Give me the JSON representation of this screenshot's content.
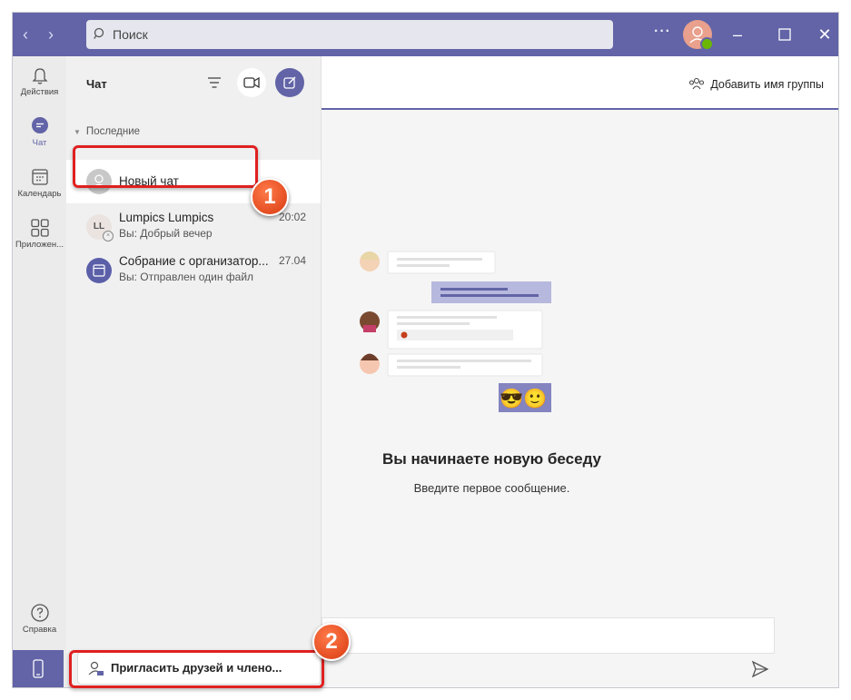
{
  "search": {
    "placeholder": "Поиск"
  },
  "titlebar": {
    "more_label": "···"
  },
  "rail": {
    "items": [
      {
        "label": "Действия",
        "icon": "bell-icon"
      },
      {
        "label": "Чат",
        "icon": "chat-icon"
      },
      {
        "label": "Календарь",
        "icon": "calendar-icon"
      },
      {
        "label": "Приложен...",
        "icon": "apps-icon"
      }
    ],
    "help_label": "Справка"
  },
  "chatlist": {
    "title": "Чат",
    "section": "Последние",
    "items": [
      {
        "name": "Новый чат",
        "preview": "",
        "time": ""
      },
      {
        "name": "Lumpics Lumpics",
        "initials": "LL",
        "preview": "Вы: Добрый вечер",
        "time": "20:02"
      },
      {
        "name": "Собрание с организатор...",
        "preview": "Вы: Отправлен один файл",
        "time": "27.04"
      }
    ],
    "invite_label": "Пригласить друзей и члено..."
  },
  "main": {
    "add_group_label": "Добавить имя группы",
    "heading": "Вы начинаете новую беседу",
    "subheading": "Введите первое сообщение.",
    "emoji": "😎🙂"
  },
  "annotations": {
    "badge1": "1",
    "badge2": "2"
  },
  "colors": {
    "accent": "#6264a7",
    "highlight": "#e02020",
    "badge": "#e8521e"
  }
}
